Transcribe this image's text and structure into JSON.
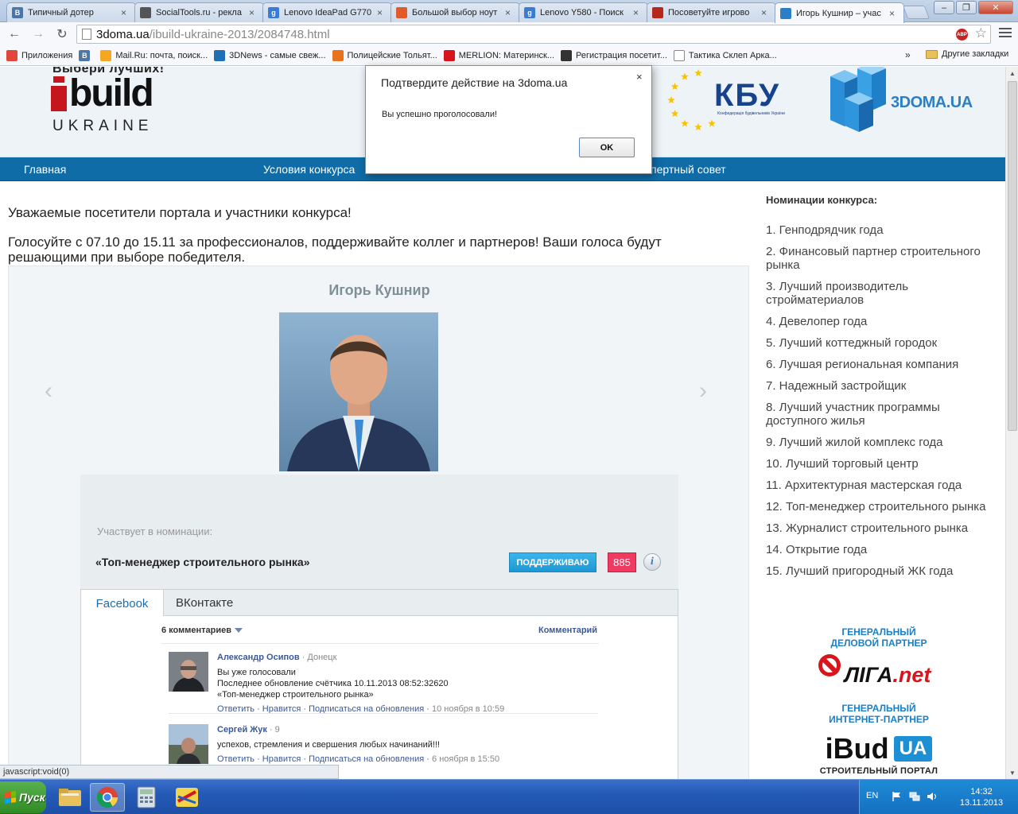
{
  "browser": {
    "tabs": [
      {
        "label": "Типичный дотер",
        "icon": "vk-icon",
        "color": "#4a76a8",
        "glyph": "В"
      },
      {
        "label": "SocialTools.ru - рекла",
        "icon": "socialtools-icon",
        "color": "#555555",
        "glyph": ""
      },
      {
        "label": "Lenovo IdeaPad G770",
        "icon": "google-icon",
        "color": "#3a7bd5",
        "glyph": "g"
      },
      {
        "label": "Большой выбор ноут",
        "icon": "rozetka-icon",
        "color": "#e05a2b",
        "glyph": ""
      },
      {
        "label": "Lenovo Y580 - Поиск",
        "icon": "google-icon",
        "color": "#3a7bd5",
        "glyph": "g"
      },
      {
        "label": "Посоветуйте игрово",
        "icon": "dota-icon",
        "color": "#b7281c",
        "glyph": ""
      },
      {
        "label": "Игорь Кушнир – учас",
        "icon": "3doma-icon",
        "color": "#2c7fc5",
        "glyph": ""
      }
    ],
    "active_tab_index": 6,
    "url_host": "3doma.ua",
    "url_path": "/ibuild-ukraine-2013/2084748.html",
    "abp_label": "ABP",
    "bookmarks": [
      {
        "label": "Приложения",
        "icon": "apps-grid-icon"
      },
      {
        "label": "",
        "icon": "vk-icon"
      },
      {
        "label": "Mail.Ru: почта, поиск...",
        "icon": "mailru-icon"
      },
      {
        "label": "3DNews - самые свеж...",
        "icon": "3dnews-icon"
      },
      {
        "label": "Полицейские Тольят...",
        "icon": "police-icon"
      },
      {
        "label": "MERLION: Материнск...",
        "icon": "merlion-icon"
      },
      {
        "label": "Регистрация посетит...",
        "icon": "registration-icon"
      },
      {
        "label": "Тактика Склеп Арка...",
        "icon": "page-icon"
      }
    ],
    "bookmarks_more": "»",
    "other_bookmarks": "Другие закладки",
    "status_text": "javascript:void(0)"
  },
  "header": {
    "slogan": "Выбери лучших!",
    "logo_text": "build",
    "logo_sub": "UKRAINE",
    "kbu_text": "КБУ",
    "kbu_sub": "Конфедерація будівельників України",
    "doma_logo": "3DOMA.UA"
  },
  "nav": {
    "items": [
      "Главная",
      "Условия конкурса",
      "пертный совет"
    ]
  },
  "main": {
    "intro_line1": "Уважаемые посетители портала и участники конкурса!",
    "intro_line2": "Голосуйте с 07.10 до 15.11 за профессионалов, поддерживайте коллег и партнеров! Ваши голоса будут решающими при выборе победителя."
  },
  "candidate": {
    "name": "Игорь Кушнир",
    "nomination_label": "Участвует в номинации:",
    "nomination": "«Топ-менеджер строительного рынка»",
    "support_label": "ПОДДЕРЖИВАЮ",
    "votes": "885",
    "info_glyph": "i"
  },
  "social": {
    "tabs": [
      "Facebook",
      "ВКонтакте"
    ],
    "active_tab": 0,
    "comments_count": "6 комментариев",
    "comment_link": "Комментарий",
    "comments": [
      {
        "author": "Александр Осипов",
        "meta": " · Донецк",
        "lines": [
          "Вы уже голосовали",
          "Последнее обновление счётчика 10.11.2013 08:52:32620",
          "«Топ-менеджер строительного рынка»"
        ],
        "actions": "Ответить · Нравится · Подписаться на обновления · ",
        "time": "10 ноября в 10:59"
      },
      {
        "author": "Сергей Жук",
        "meta": " · 9",
        "lines": [
          "успехов, стремления и свершения любых начинаний!!!"
        ],
        "actions": "Ответить · Нравится · Подписаться на обновления · ",
        "time": "6 ноября в 15:50"
      }
    ]
  },
  "sidebar": {
    "title": "Номинации конкурса:",
    "items": [
      "1. Генподрядчик года",
      "2. Финансовый партнер строительного рынка",
      "3. Лучший производитель стройматериалов",
      "4. Девелопер года",
      "5. Лучший коттеджный городок",
      "6. Лучшая региональная компания",
      "7. Надежный застройщик",
      "8. Лучший участник программы доступного жилья",
      "9. Лучший жилой комплекс года",
      "10. Лучший торговый центр",
      "11. Архитектурная мастерская года",
      "12. Топ-менеджер строительного рынка",
      "13. Журналист строительного рынка",
      "14. Открытие года",
      "15. Лучший пригородный ЖК года"
    ],
    "partner1_label": "ГЕНЕРАЛЬНЫЙ ДЕЛОВОЙ ПАРТНЕР",
    "partner1_logo_a": "ЛІГА",
    "partner1_logo_b": ".net",
    "partner2_label": "ГЕНЕРАЛЬНЫЙ ИНТЕРНЕТ-ПАРТНЕР",
    "partner2_logo": "iBud",
    "partner2_logo_ua": "UA",
    "partner2_sub": "СТРОИТЕЛЬНЫЙ ПОРТАЛ"
  },
  "dialog": {
    "title": "Подтвердите действие на 3doma.ua",
    "message": "Вы успешно проголосовали!",
    "ok_label": "OK",
    "close_glyph": "×"
  },
  "taskbar": {
    "start_label": "Пуск",
    "lang": "EN",
    "time": "14:32",
    "date": "13.11.2013"
  }
}
